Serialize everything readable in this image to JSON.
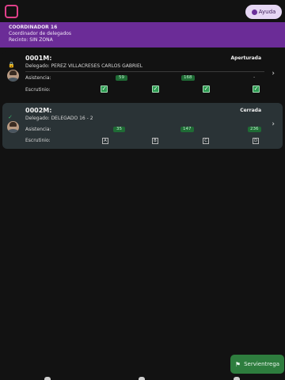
{
  "header": {
    "help_label": "Ayuda"
  },
  "banner": {
    "title": "COORDINADOR 16",
    "role": "Coordinador de delegados",
    "site": "Recinto: SIN ZONA"
  },
  "cards": [
    {
      "code": "0001M:",
      "status": "Aperturada",
      "delegate": "Delegado: PEREZ VILLACRESES CARLOS GABRIEL",
      "attendance_label": "Asistencia:",
      "attendance": [
        "59",
        "168",
        "-"
      ],
      "scrutiny_label": "Escrutinio:"
    },
    {
      "code": "0002M:",
      "status": "Cerrada",
      "delegate": "Delegado: DELEGADO 16 - 2",
      "attendance_label": "Asistencia:",
      "attendance": [
        "35",
        "147",
        "236"
      ],
      "scrutiny_label": "Escrutinio:",
      "scrutiny_boxes": [
        "A",
        "B",
        "C",
        "D"
      ]
    }
  ],
  "fab": {
    "label": "Servientrega"
  },
  "icons": {
    "logo": "app-logo-icon",
    "help": "help-icon",
    "open": "lock-icon",
    "closed": "check-icon",
    "chevron": "chevron-right-icon",
    "fab": "delivery-icon"
  },
  "colors": {
    "banner": "#6b2c97",
    "accent": "#e0408a",
    "pill": "#1f6b35",
    "fab": "#2e7d3e"
  }
}
